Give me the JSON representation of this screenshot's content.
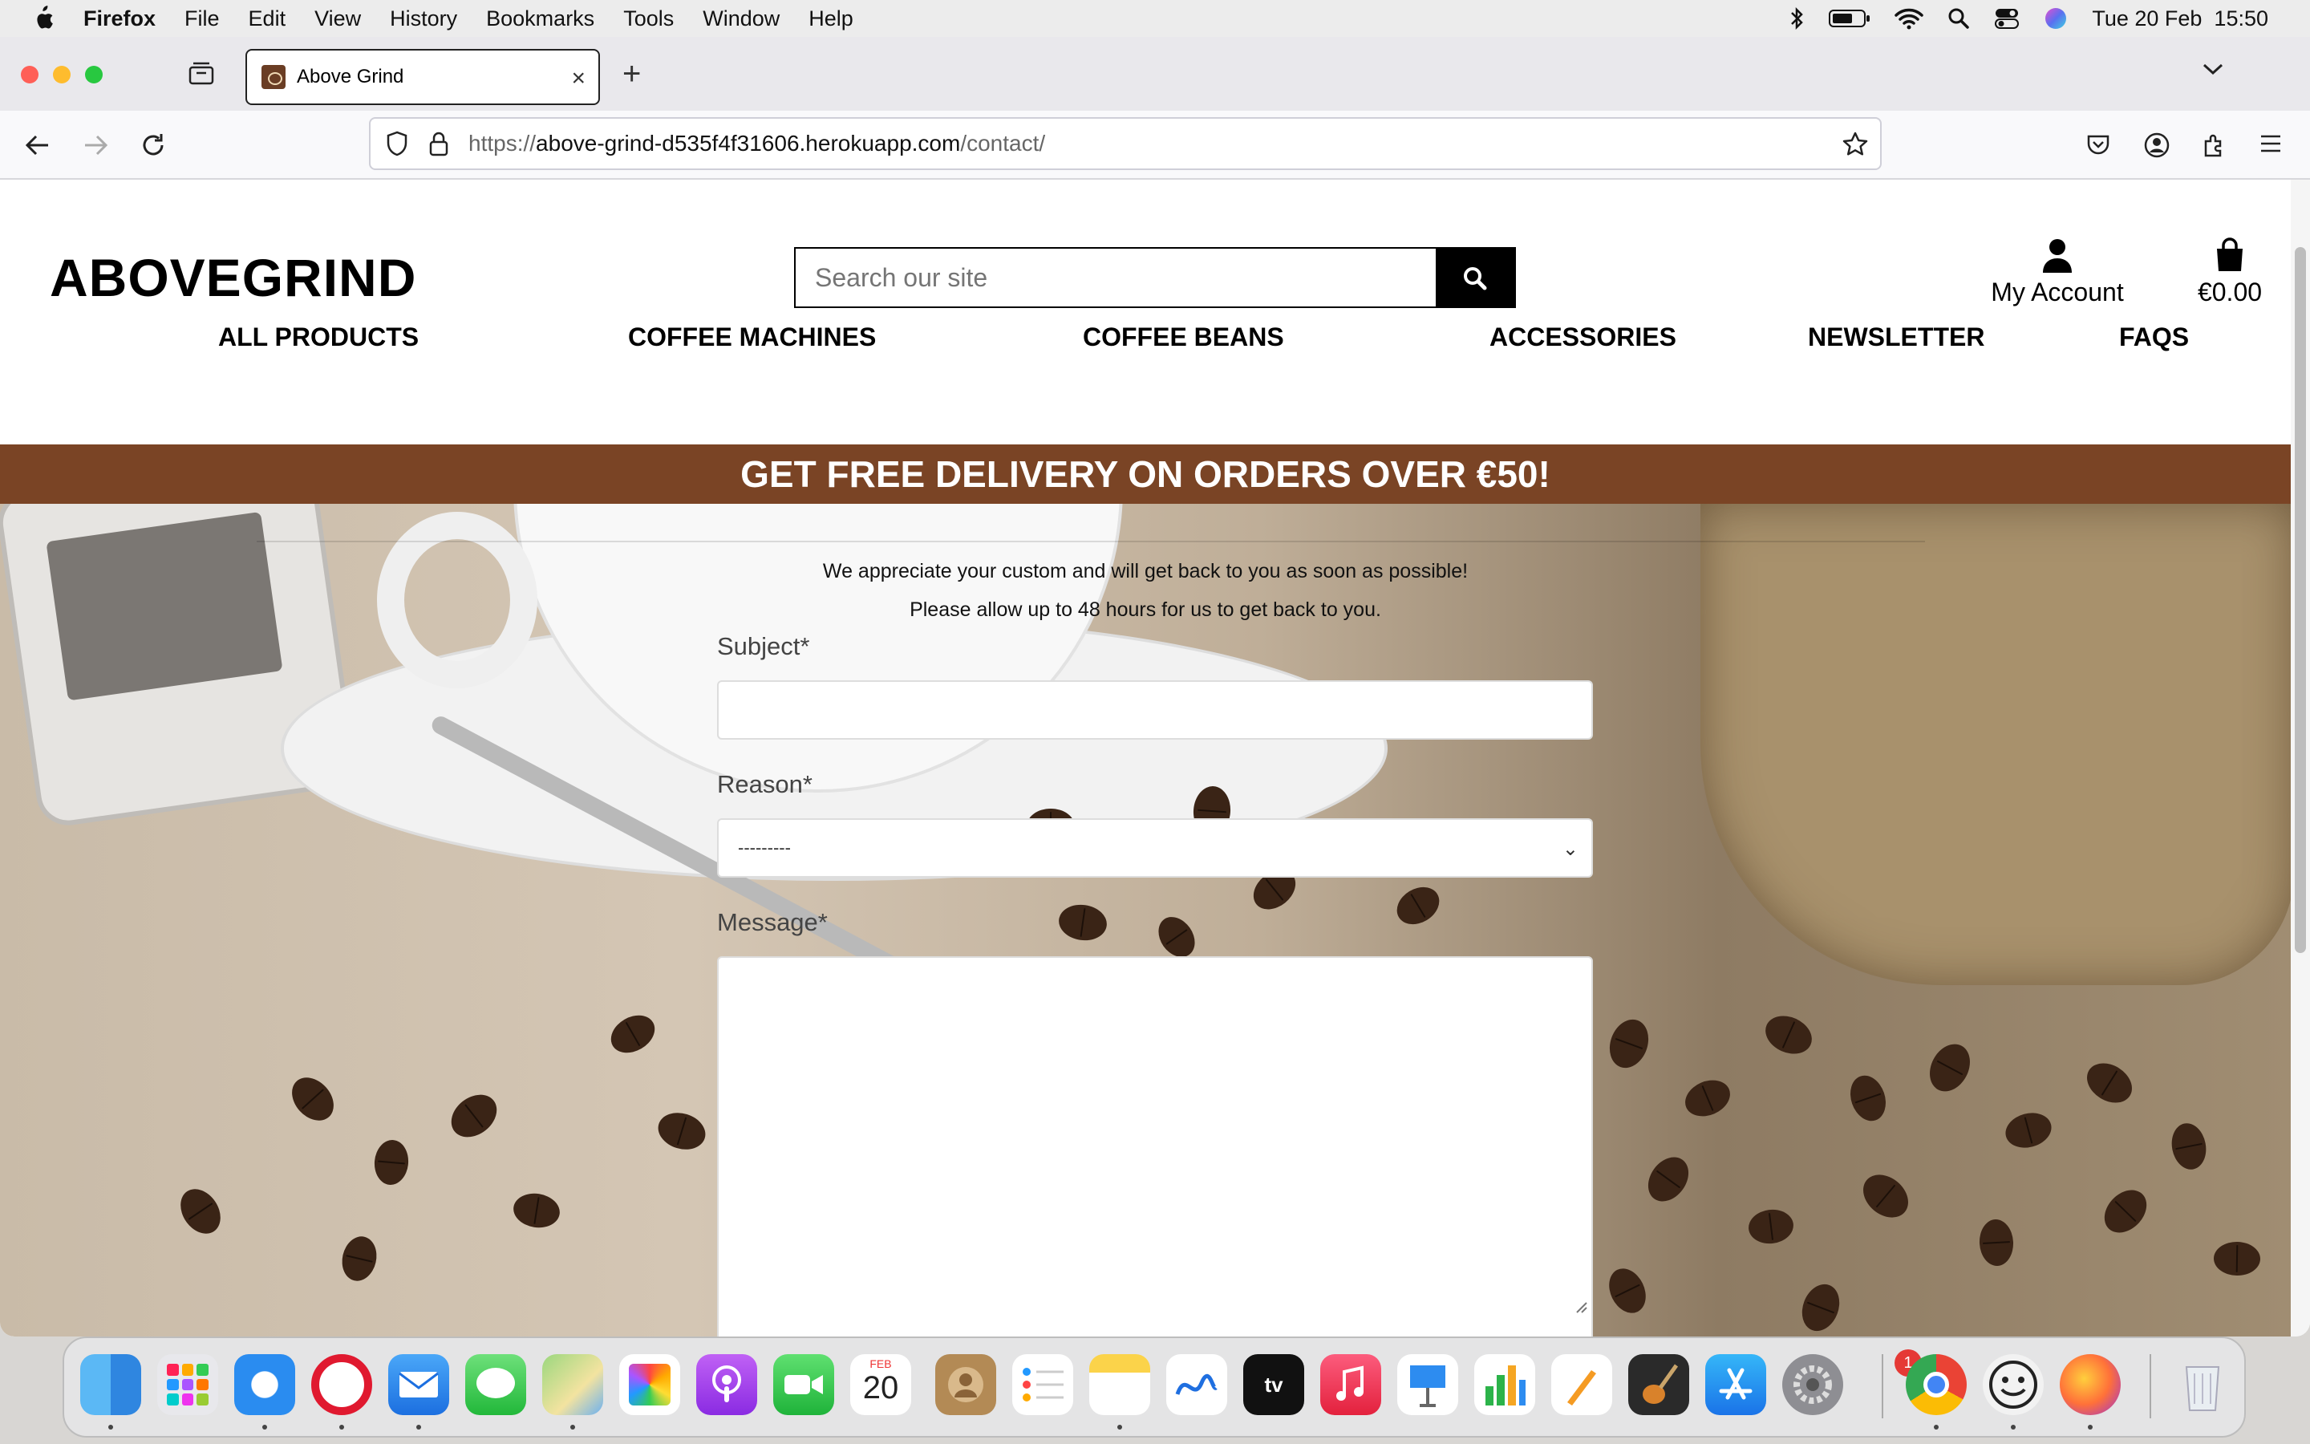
{
  "menubar": {
    "app": "Firefox",
    "items": [
      "File",
      "Edit",
      "View",
      "History",
      "Bookmarks",
      "Tools",
      "Window",
      "Help"
    ],
    "datetime": "Tue 20 Feb  15:50"
  },
  "browser": {
    "tab_title": "Above Grind",
    "url_scheme": "https://",
    "url_host": "above-grind-d535f4f31606.herokuapp.com",
    "url_path": "/contact/"
  },
  "site": {
    "logo": "ABOVEGRIND",
    "search_placeholder": "Search our site",
    "account_label": "My Account",
    "bag_total": "€0.00",
    "nav": [
      "ALL PRODUCTS",
      "COFFEE MACHINES",
      "COFFEE BEANS",
      "ACCESSORIES",
      "NEWSLETTER",
      "FAQS"
    ],
    "banner": "GET FREE DELIVERY ON ORDERS OVER €50!"
  },
  "contact": {
    "line1": "We appreciate your custom and will get back to you as soon as possible!",
    "line2": "Please allow up to 48 hours for us to get back to you.",
    "subject_label": "Subject*",
    "reason_label": "Reason*",
    "reason_selected": "---------",
    "message_label": "Message*"
  },
  "dock": {
    "calendar_month": "FEB",
    "calendar_day": "20",
    "settings_badge": "1",
    "apps": [
      "Finder",
      "Launchpad",
      "Safari",
      "Opera",
      "Mail",
      "Messages",
      "Maps",
      "Photos",
      "Podcasts",
      "FaceTime",
      "Calendar",
      "Contacts",
      "Reminders",
      "Notes",
      "Freeform",
      "TV",
      "Music",
      "Keynote",
      "Numbers",
      "Pages",
      "GarageBand",
      "App Store",
      "System Settings",
      "Chrome",
      "Emoji",
      "Firefox",
      "Trash"
    ]
  },
  "colors": {
    "banner": "#7a4425",
    "black": "#000000"
  }
}
